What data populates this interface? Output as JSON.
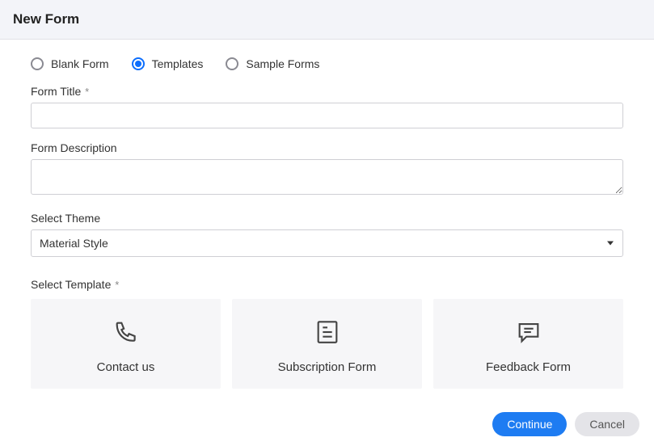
{
  "header": {
    "title": "New Form"
  },
  "form_type": {
    "options": [
      {
        "label": "Blank Form",
        "selected": false
      },
      {
        "label": "Templates",
        "selected": true
      },
      {
        "label": "Sample Forms",
        "selected": false
      }
    ]
  },
  "fields": {
    "title": {
      "label": "Form Title",
      "required": "*",
      "value": ""
    },
    "description": {
      "label": "Form Description",
      "value": ""
    },
    "theme": {
      "label": "Select Theme",
      "value": "Material Style"
    },
    "template": {
      "label": "Select Template",
      "required": "*"
    }
  },
  "templates": [
    {
      "label": "Contact us",
      "icon": "phone-icon"
    },
    {
      "label": "Subscription Form",
      "icon": "document-icon"
    },
    {
      "label": "Feedback Form",
      "icon": "chat-icon"
    }
  ],
  "buttons": {
    "continue": "Continue",
    "cancel": "Cancel"
  }
}
